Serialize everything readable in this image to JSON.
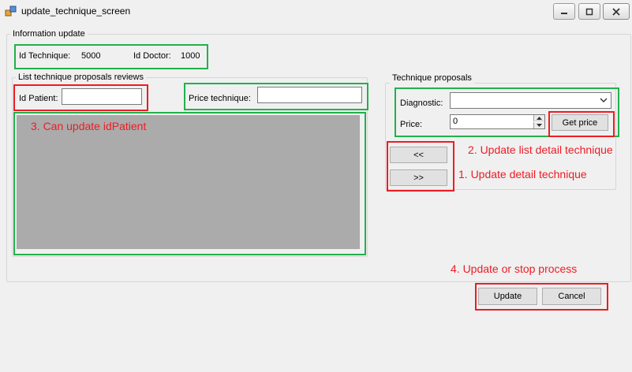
{
  "window": {
    "title": "update_technique_screen",
    "icon": "app-icon",
    "controls": [
      "minimize-icon",
      "maximize-icon",
      "close-icon"
    ]
  },
  "info_group": {
    "title": "Information update",
    "id_technique_label": "Id Technique:",
    "id_technique_value": "5000",
    "id_doctor_label": "Id Doctor:",
    "id_doctor_value": "1000"
  },
  "list_group": {
    "title": "List technique proposals reviews",
    "id_patient_label": "Id Patient:",
    "id_patient_value": "",
    "price_technique_label": "Price technique:",
    "price_technique_value": ""
  },
  "proposals_group": {
    "title": "Technique proposals",
    "diagnostic_label": "Diagnostic:",
    "diagnostic_selected": "",
    "price_label": "Price:",
    "price_value": "0",
    "get_price_label": "Get price",
    "move_left_label": "<<",
    "move_right_label": ">>"
  },
  "actions": {
    "update_label": "Update",
    "cancel_label": "Cancel"
  },
  "annotations": {
    "note_1": "1. Update detail technique",
    "note_2": "2. Update list detail technique",
    "note_3": "3. Can update idPatient",
    "note_4": "4. Update or stop process"
  },
  "colors": {
    "annotation_green": "#22b14c",
    "annotation_red": "#ed1c24",
    "grid_background": "#ababab",
    "window_background": "#f0f0f0"
  }
}
